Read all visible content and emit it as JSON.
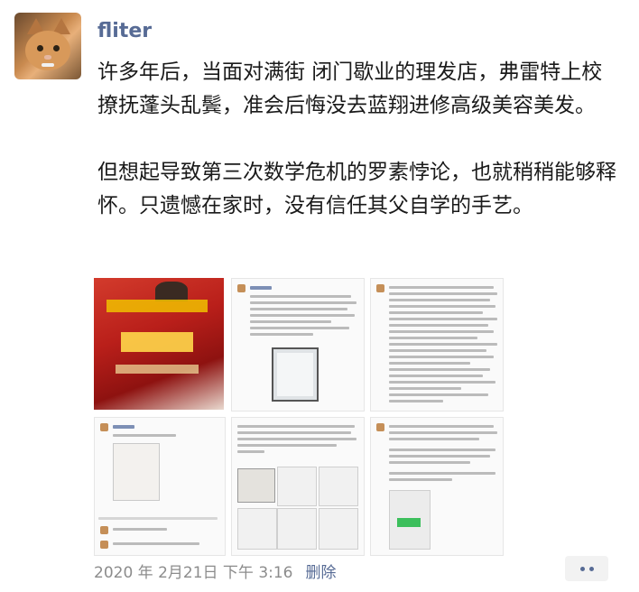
{
  "post": {
    "author": "fliter",
    "paragraph1": "许多年后，当面对满街 闭门歇业的理发店，弗雷特上校撩抚蓬头乱鬓，准会后悔没去蓝翔进修高级美容美发。",
    "paragraph2": "但想起导致第三次数学危机的罗素悖论，也就稍稍能够释怀。只遗憾在家时，没有信任其父自学的手艺。",
    "timestamp": "2020 年 2月21日 下午 3:16",
    "delete_label": "删除"
  },
  "images": [
    {
      "name": "image-1"
    },
    {
      "name": "image-2"
    },
    {
      "name": "image-3"
    },
    {
      "name": "image-4"
    },
    {
      "name": "image-5"
    },
    {
      "name": "image-6"
    }
  ],
  "icons": {
    "avatar": "cat-avatar-icon",
    "more": "more-dots-icon"
  },
  "colors": {
    "author_name": "#576b95",
    "text": "#1a1a1a",
    "meta": "#8c8c8c",
    "link": "#576b95",
    "more_bg": "#f2f2f2"
  }
}
